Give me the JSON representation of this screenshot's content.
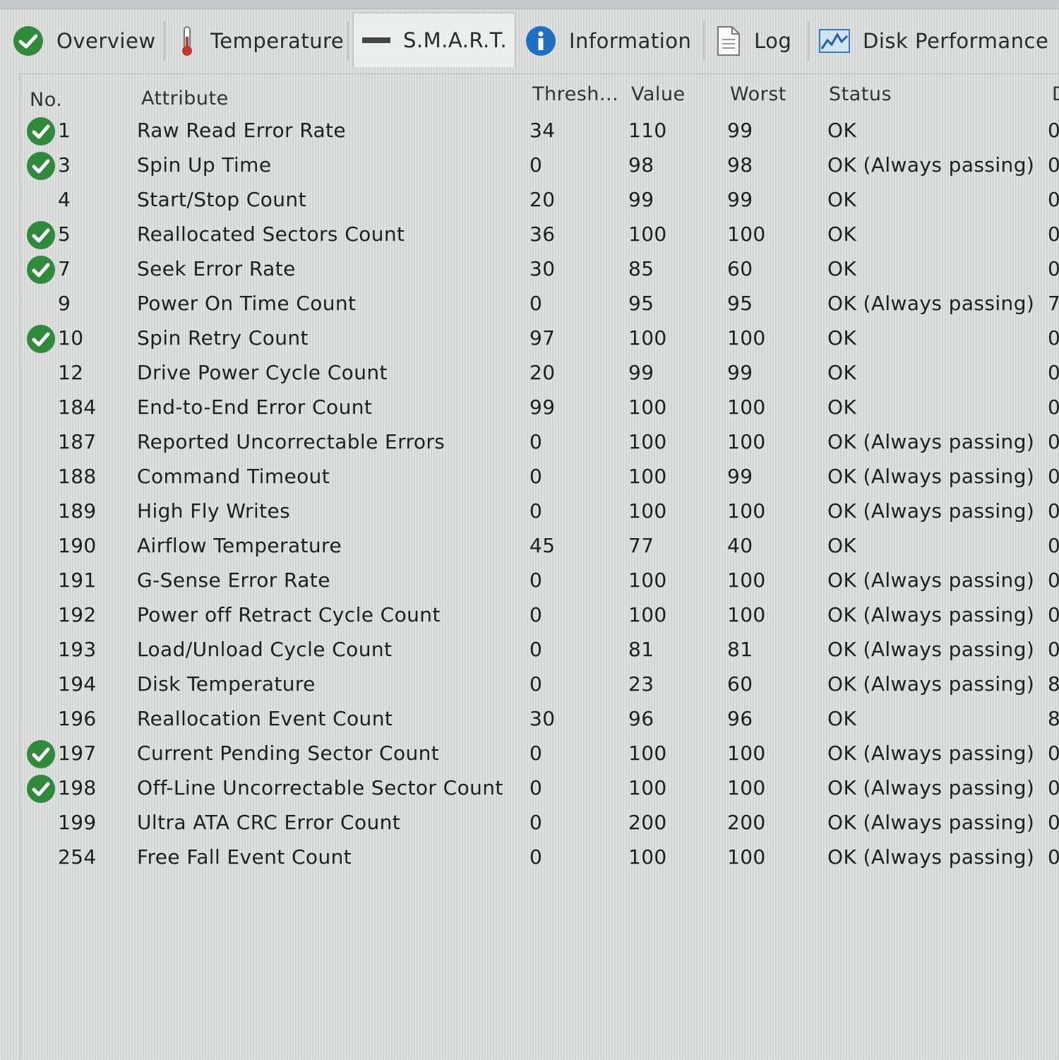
{
  "tabs": [
    {
      "label": "Overview",
      "icon": "check-circle-icon"
    },
    {
      "label": "Temperature",
      "icon": "thermometer-icon"
    },
    {
      "label": "S.M.A.R.T.",
      "icon": "dash-icon"
    },
    {
      "label": "Information",
      "icon": "info-icon"
    },
    {
      "label": "Log",
      "icon": "document-icon"
    },
    {
      "label": "Disk Performance",
      "icon": "chart-icon"
    }
  ],
  "table": {
    "headers": {
      "no": "No.",
      "attribute": "Attribute",
      "threshold": "Thresh...",
      "value": "Value",
      "worst": "Worst",
      "status": "Status",
      "data": "D"
    },
    "rows": [
      {
        "no": "1",
        "attr": "Raw Read Error Rate",
        "thresh": "34",
        "value": "110",
        "worst": "99",
        "status": "OK",
        "data": "0",
        "check": true
      },
      {
        "no": "3",
        "attr": "Spin Up Time",
        "thresh": "0",
        "value": "98",
        "worst": "98",
        "status": "OK (Always passing)",
        "data": "0",
        "check": true
      },
      {
        "no": "4",
        "attr": "Start/Stop Count",
        "thresh": "20",
        "value": "99",
        "worst": "99",
        "status": "OK",
        "data": "0",
        "check": false
      },
      {
        "no": "5",
        "attr": "Reallocated Sectors Count",
        "thresh": "36",
        "value": "100",
        "worst": "100",
        "status": "OK",
        "data": "0",
        "check": true
      },
      {
        "no": "7",
        "attr": "Seek Error Rate",
        "thresh": "30",
        "value": "85",
        "worst": "60",
        "status": "OK",
        "data": "0",
        "check": true
      },
      {
        "no": "9",
        "attr": "Power On Time Count",
        "thresh": "0",
        "value": "95",
        "worst": "95",
        "status": "OK (Always passing)",
        "data": "7",
        "check": false
      },
      {
        "no": "10",
        "attr": "Spin Retry Count",
        "thresh": "97",
        "value": "100",
        "worst": "100",
        "status": "OK",
        "data": "0",
        "check": true
      },
      {
        "no": "12",
        "attr": "Drive Power Cycle Count",
        "thresh": "20",
        "value": "99",
        "worst": "99",
        "status": "OK",
        "data": "0",
        "check": false
      },
      {
        "no": "184",
        "attr": "End-to-End Error Count",
        "thresh": "99",
        "value": "100",
        "worst": "100",
        "status": "OK",
        "data": "0",
        "check": false
      },
      {
        "no": "187",
        "attr": "Reported Uncorrectable Errors",
        "thresh": "0",
        "value": "100",
        "worst": "100",
        "status": "OK (Always passing)",
        "data": "0",
        "check": false
      },
      {
        "no": "188",
        "attr": "Command Timeout",
        "thresh": "0",
        "value": "100",
        "worst": "99",
        "status": "OK (Always passing)",
        "data": "0",
        "check": false
      },
      {
        "no": "189",
        "attr": "High Fly Writes",
        "thresh": "0",
        "value": "100",
        "worst": "100",
        "status": "OK (Always passing)",
        "data": "0",
        "check": false
      },
      {
        "no": "190",
        "attr": "Airflow Temperature",
        "thresh": "45",
        "value": "77",
        "worst": "40",
        "status": "OK",
        "data": "0",
        "check": false
      },
      {
        "no": "191",
        "attr": "G-Sense Error Rate",
        "thresh": "0",
        "value": "100",
        "worst": "100",
        "status": "OK (Always passing)",
        "data": "0",
        "check": false
      },
      {
        "no": "192",
        "attr": "Power off Retract Cycle Count",
        "thresh": "0",
        "value": "100",
        "worst": "100",
        "status": "OK (Always passing)",
        "data": "0",
        "check": false
      },
      {
        "no": "193",
        "attr": "Load/Unload Cycle Count",
        "thresh": "0",
        "value": "81",
        "worst": "81",
        "status": "OK (Always passing)",
        "data": "0",
        "check": false
      },
      {
        "no": "194",
        "attr": "Disk Temperature",
        "thresh": "0",
        "value": "23",
        "worst": "60",
        "status": "OK (Always passing)",
        "data": "8",
        "check": false
      },
      {
        "no": "196",
        "attr": "Reallocation Event Count",
        "thresh": "30",
        "value": "96",
        "worst": "96",
        "status": "OK",
        "data": "8",
        "check": false
      },
      {
        "no": "197",
        "attr": "Current Pending Sector Count",
        "thresh": "0",
        "value": "100",
        "worst": "100",
        "status": "OK (Always passing)",
        "data": "0",
        "check": true
      },
      {
        "no": "198",
        "attr": "Off-Line Uncorrectable Sector Count",
        "thresh": "0",
        "value": "100",
        "worst": "100",
        "status": "OK (Always passing)",
        "data": "0",
        "check": true
      },
      {
        "no": "199",
        "attr": "Ultra ATA CRC Error Count",
        "thresh": "0",
        "value": "200",
        "worst": "200",
        "status": "OK (Always passing)",
        "data": "0",
        "check": false
      },
      {
        "no": "254",
        "attr": "Free Fall Event Count",
        "thresh": "0",
        "value": "100",
        "worst": "100",
        "status": "OK (Always passing)",
        "data": "0",
        "check": false
      }
    ]
  }
}
